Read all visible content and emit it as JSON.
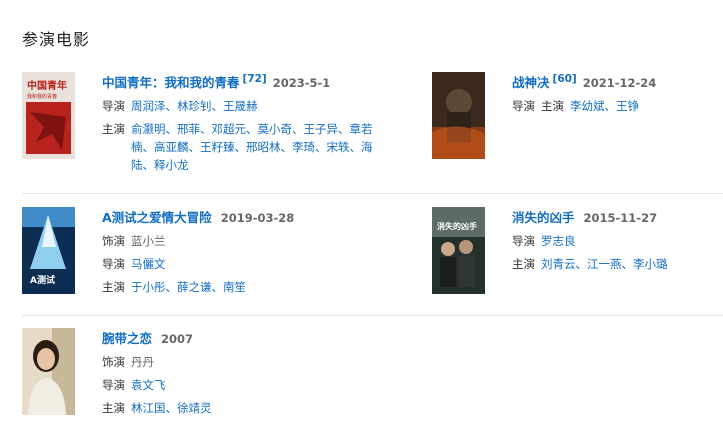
{
  "section_title": "参演电影",
  "films": [
    {
      "title": "中国青年：我和我的青春",
      "score": "[72]",
      "date": "2023-5-1",
      "poster_text": [
        "中国青年",
        "我和我的青春"
      ],
      "rows": [
        {
          "role": "导演",
          "people": [
            "周润泽",
            "林珍钊",
            "王晟赫"
          ]
        },
        {
          "role": "主演",
          "people": [
            "俞灏明",
            "邢菲",
            "邓超元",
            "莫小奇",
            "王子异",
            "章若楠",
            "高亚麟",
            "王籽臻",
            "邢昭林",
            "李琦",
            "宋轶",
            "海陆",
            "释小龙"
          ]
        }
      ]
    },
    {
      "title": "战神决",
      "score": "[60]",
      "date": "2021-12-24",
      "rows": [
        {
          "role": "导演",
          "people": []
        },
        {
          "role": "主演",
          "people": [
            "李幼斌",
            "王铮"
          ]
        }
      ]
    },
    {
      "title": "A测试之爱情大冒险",
      "score": "",
      "date": "2019-03-28",
      "poster_text": [
        "A测试"
      ],
      "rows": [
        {
          "role": "饰演",
          "people": [
            "蓝小兰"
          ],
          "plain": true
        },
        {
          "role": "导演",
          "people": [
            "马儷文"
          ]
        },
        {
          "role": "主演",
          "people": [
            "于小彤",
            "薛之谦",
            "南笙"
          ]
        }
      ]
    },
    {
      "title": "消失的凶手",
      "score": "",
      "date": "2015-11-27",
      "poster_text": [
        "消失的凶手"
      ],
      "rows": [
        {
          "role": "导演",
          "people": [
            "罗志良"
          ]
        },
        {
          "role": "主演",
          "people": [
            "刘青云",
            "江一燕",
            "李小璐"
          ]
        }
      ]
    },
    {
      "title": "腕带之恋",
      "score": "",
      "date": "2007",
      "rows": [
        {
          "role": "饰演",
          "people": [
            "丹丹"
          ],
          "plain": true
        },
        {
          "role": "导演",
          "people": [
            "袁文飞"
          ]
        },
        {
          "role": "主演",
          "people": [
            "林江国",
            "徐靖灵"
          ]
        }
      ]
    }
  ],
  "colors": {
    "link": "#136ec2",
    "muted": "#666666",
    "separator": "#e6e6e6"
  }
}
